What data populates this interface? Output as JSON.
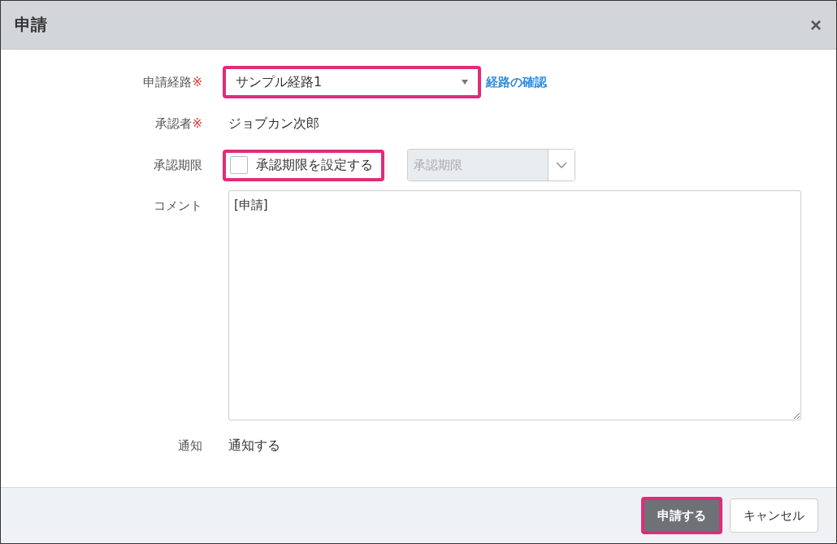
{
  "dialog": {
    "title": "申請",
    "close": "×"
  },
  "route": {
    "label": "申請経路",
    "required_mark": "※",
    "value": "サンプル経路1",
    "highlighted": true,
    "link": "経路の確認"
  },
  "approver": {
    "label": "承認者",
    "required_mark": "※",
    "value": "ジョブカン次郎"
  },
  "deadline": {
    "label": "承認期限",
    "checkbox_label": "承認期限を設定する",
    "checked": false,
    "highlighted": true,
    "placeholder": "承認期限",
    "disabled": true
  },
  "comment": {
    "label": "コメント",
    "value": "[申請]"
  },
  "notification": {
    "label": "通知",
    "value": "通知する"
  },
  "buttons": [
    {
      "label": "申請する",
      "kind": "primary",
      "highlighted": true
    },
    {
      "label": "キャンセル",
      "kind": "secondary",
      "highlighted": false
    }
  ]
}
